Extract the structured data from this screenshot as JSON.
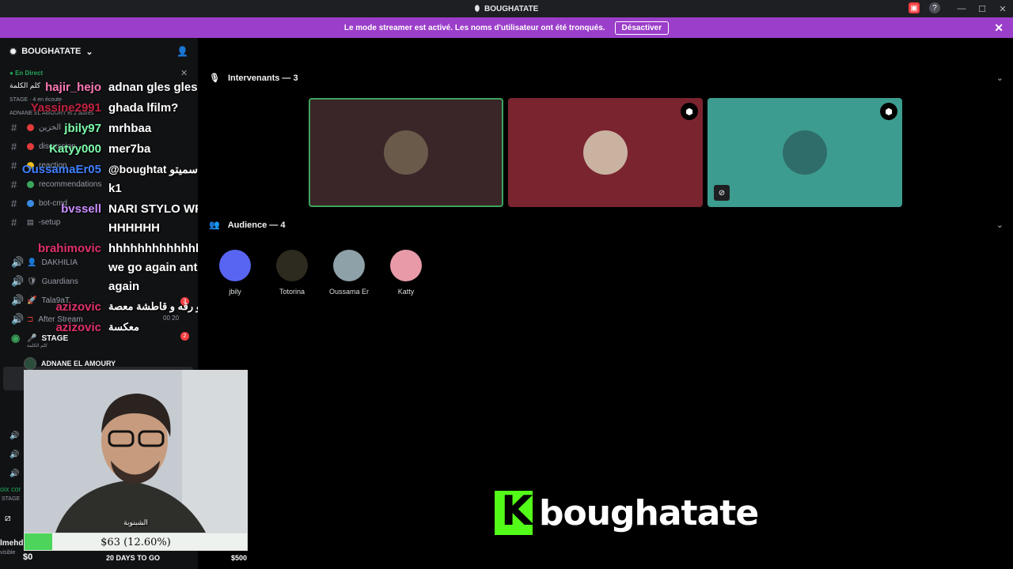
{
  "window": {
    "title": "BOUGHATATE"
  },
  "banner": {
    "text": "Le mode streamer est activé. Les noms d'utilisateur ont été tronqués.",
    "button": "Désactiver"
  },
  "sidebar": {
    "server_name": "BOUGHATATE",
    "live_label": "En Direct",
    "live_title": "كلم الكلمة",
    "live_meta": "STAGE · 4 en écoute",
    "live_participants": "ADNANE EL AMOURY et 2 autres",
    "channels": [
      {
        "name": "الخزين"
      },
      {
        "name": "discussion"
      },
      {
        "name": "reaction"
      },
      {
        "name": "recommendations"
      },
      {
        "name": "bot-cmd"
      },
      {
        "name": "-setup"
      }
    ],
    "voice_channels": [
      {
        "name": "DAKHILIA"
      },
      {
        "name": "Guardians"
      },
      {
        "name": "Tala9aT",
        "badge": "3"
      },
      {
        "name": "After Stream",
        "extra": "00   20"
      },
      {
        "name": "STAGE",
        "badge": "2",
        "sub": "كلم الكلمة"
      }
    ],
    "stage_member": "ADNANE EL AMOURY",
    "partial_1": "oix cor",
    "partial_2": "STAGE",
    "partial_3": "lmehd",
    "partial_4": "visible"
  },
  "chat": [
    {
      "user": "hajir_hejo",
      "text": "adnan gles gles",
      "color": "#ff7ab8"
    },
    {
      "user": "Yassine2991",
      "text": "ghada lfilm?",
      "color": "#c0223f"
    },
    {
      "user": "jbily97",
      "text": "mrhbaa",
      "color": "#7cfcaa"
    },
    {
      "user": "Katyy000",
      "text": "mer7ba",
      "color": "#7cfcaa"
    },
    {
      "user": "OussamaEr05",
      "text": "@boughtat شي مسلسل سميتو",
      "color": "#3f7fff"
    },
    {
      "user": "",
      "text": "k1",
      "color": "#ffffff"
    },
    {
      "user": "bvssell",
      "text": "NARI STYLO WRQA",
      "color": "#c78cff"
    },
    {
      "user": "",
      "text": "HHHHHH",
      "color": "#ffffff"
    },
    {
      "user": "brahimovic",
      "text": "hhhhhhhhhhhhh shit here",
      "color": "#e0306a"
    },
    {
      "user": "",
      "text": "we go again antkhrbo",
      "color": "#ffffff"
    },
    {
      "user": "",
      "text": "again",
      "color": "#ffffff"
    },
    {
      "user": "azizovic",
      "text": "ستيلو و رقه و قاطشة معصة",
      "color": "#e0306a"
    },
    {
      "user": "azizovic",
      "text": "معكسة",
      "color": "#e0306a"
    }
  ],
  "stage": {
    "speakers_label": "Intervenants — 3",
    "audience_label": "Audience — 4",
    "speakers": [
      {
        "bg": "#3a2528",
        "avatar": "#6a5a4a",
        "border": "#3ba55c"
      },
      {
        "bg": "#7a2430",
        "avatar": "#c9b2a0"
      },
      {
        "bg": "#3d9c90",
        "avatar": "#2f6d6a"
      }
    ],
    "audience": [
      {
        "name": "jbily",
        "color": "#5865f2"
      },
      {
        "name": "Totorina",
        "color": "#2d2a1f"
      },
      {
        "name": "Oussama Er",
        "color": "#8ea0a8"
      },
      {
        "name": "Katty",
        "color": "#e89aa8"
      }
    ]
  },
  "webcam": {
    "label": "الشبنوبة"
  },
  "goal": {
    "text": "$63 (12.60%)",
    "fraction": 0.126,
    "min": "$0",
    "max": "$500",
    "days": "20 DAYS TO GO"
  },
  "logo": {
    "letter": "K",
    "word": "boughatate"
  }
}
